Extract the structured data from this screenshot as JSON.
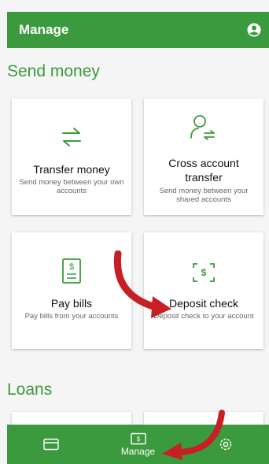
{
  "header": {
    "title": "Manage",
    "account_icon": "account-circle-icon"
  },
  "sections": {
    "send_money": {
      "title": "Send money"
    },
    "loans": {
      "title": "Loans"
    }
  },
  "cards": {
    "transfer": {
      "title": "Transfer money",
      "subtitle": "Send money between your own accounts",
      "icon": "transfer-arrows-icon"
    },
    "cross": {
      "title_line1": "Cross account",
      "title_line2": "transfer",
      "subtitle": "Send money between your shared accounts",
      "icon": "person-transfer-icon"
    },
    "paybills": {
      "title": "Pay bills",
      "subtitle": "Pay bills from your accounts",
      "icon": "bill-icon"
    },
    "deposit": {
      "title": "Deposit check",
      "subtitle": "Deposit check to your account",
      "icon": "check-scan-icon"
    }
  },
  "bottom_nav": {
    "items": [
      {
        "icon": "card-icon",
        "label": ""
      },
      {
        "icon": "manage-icon",
        "label": "Manage"
      },
      {
        "icon": "settings-icon",
        "label": ""
      }
    ]
  },
  "colors": {
    "brand": "#3c9a3e",
    "annotation_arrow": "#c62026"
  }
}
